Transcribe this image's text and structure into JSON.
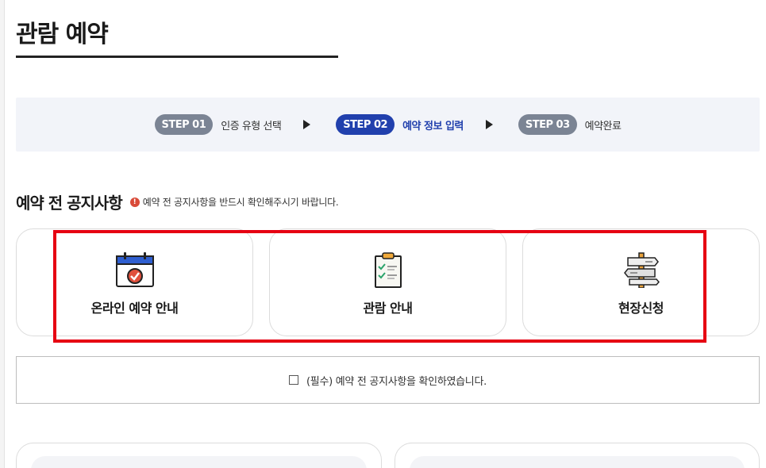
{
  "page": {
    "title": "관람 예약"
  },
  "steps": [
    {
      "badge": "STEP 01",
      "label": "인증 유형 선택",
      "active": false
    },
    {
      "badge": "STEP 02",
      "label": "예약 정보 입력",
      "active": true
    },
    {
      "badge": "STEP 03",
      "label": "예약완료",
      "active": false
    }
  ],
  "notice": {
    "title": "예약 전 공지사항",
    "warning_icon": "!",
    "subtitle": "예약 전 공지사항을 반드시 확인해주시기 바랍니다."
  },
  "cards": [
    {
      "label": "온라인 예약 안내",
      "icon": "calendar-check-icon"
    },
    {
      "label": "관람 안내",
      "icon": "clipboard-checklist-icon"
    },
    {
      "label": "현장신청",
      "icon": "signpost-icon"
    }
  ],
  "agreement": {
    "text": "(필수) 예약 전 공지사항을 확인하였습니다.",
    "checked": false
  },
  "colors": {
    "active_step": "#2140ad",
    "inactive_step": "#7b8494",
    "highlight": "#e60012",
    "warning": "#d94a38",
    "steps_background": "#f2f4f9"
  }
}
